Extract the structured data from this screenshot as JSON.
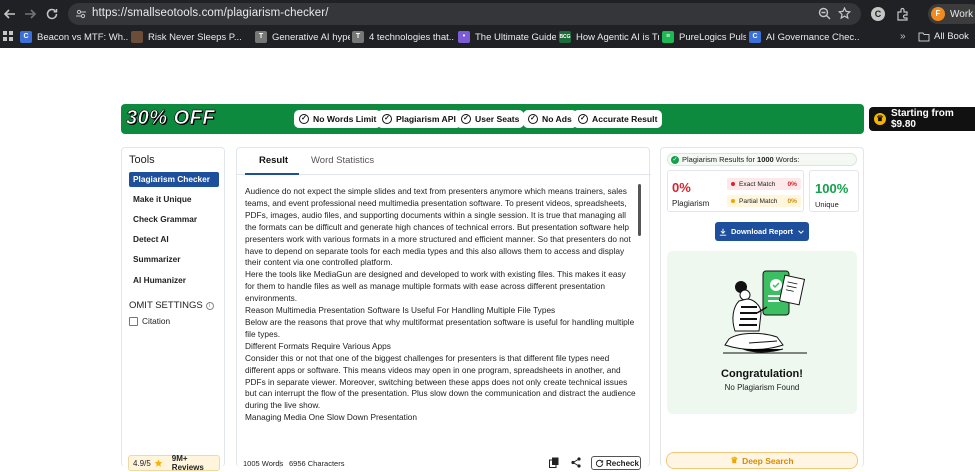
{
  "browser": {
    "url": "https://smallseotools.com/plagiarism-checker/",
    "profile_label": "Work",
    "profile_initial": "F",
    "extension_initial": "C",
    "bookmarks": [
      {
        "label": "Beacon vs MTF: Wh...",
        "icon": "c-favicon",
        "color": "#3c6fd8",
        "glyph": "C"
      },
      {
        "label": "Risk Never Sleeps P...",
        "icon": "image-favicon",
        "color": "#6b4d3a",
        "glyph": ""
      },
      {
        "label": "Generative AI hype...",
        "icon": "t-favicon",
        "color": "#777777",
        "glyph": "T"
      },
      {
        "label": "4 technologies that...",
        "icon": "t-favicon",
        "color": "#777777",
        "glyph": "T"
      },
      {
        "label": "The Ultimate Guide...",
        "icon": "purple-favicon",
        "color": "#7b5cd6",
        "glyph": "•"
      },
      {
        "label": "How Agentic AI is Tr...",
        "icon": "bcg-favicon",
        "color": "#1d6b3a",
        "glyph": "BCG"
      },
      {
        "label": "PureLogics Pulse | P...",
        "icon": "spotify-icon",
        "color": "#1db954",
        "glyph": "≡"
      },
      {
        "label": "AI Governance Chec...",
        "icon": "c-favicon",
        "color": "#3c6fd8",
        "glyph": "C"
      }
    ],
    "bookmarks_more": "»",
    "all_bookmarks": "All Book"
  },
  "promo": {
    "discount": "30% OFF",
    "features": [
      "No Words Limit",
      "Plagiarism API",
      "User Seats",
      "No Ads",
      "Accurate Result"
    ],
    "cta": "Starting from $9.80"
  },
  "tools": {
    "title": "Tools",
    "items": [
      "Plagiarism Checker",
      "Make it Unique",
      "Check Grammar",
      "Detect AI",
      "Summarizer",
      "AI Humanizer"
    ],
    "active_index": 0,
    "omit_title": "OMIT SETTINGS",
    "citation_label": "Citation",
    "rating": "4.9/5",
    "reviews": "9M+ Reviews"
  },
  "result": {
    "tabs": [
      "Result",
      "Word Statistics"
    ],
    "paragraphs": [
      "Audience do not expect the simple slides and text from presenters anymore which means trainers, sales teams, and event professional need multimedia presentation software. To present videos, spreadsheets, PDFs, images, audio files, and supporting documents within a single session. It is true that managing all the formats can be difficult and generate high chances of technical errors. But presentation software help presenters work with various formats in a more structured and efficient manner. So that presenters do not have to depend on separate tools for each media types and this also allows them to access and display their content via one controlled platform.",
      "Here the tools like MediaGun are designed and developed to work with existing files. This makes it easy for them to handle files as well as manage multiple formats with ease across different presentation environments.",
      "Reason Multimedia Presentation Software Is Useful For Handling Multiple File Types",
      "Below are the reasons that prove that why multiformat presentation software is useful for handling multiple file types.",
      "Different Formats Require Various Apps",
      "Consider this or not that one of the biggest challenges for presenters is that different file types need different apps or software. This means videos may open in one program, spreadsheets in another, and PDFs in separate viewer. Moreover, switching between these apps does not only create technical issues but can interrupt the flow of the presentation. Plus slow down the communication and distract the audience during the live show.",
      "Managing Media One Slow Down Presentation"
    ],
    "word_count": "1005 Words",
    "char_count": "6956 Characters",
    "recheck_label": "Recheck"
  },
  "results_panel": {
    "header_prefix": "Plagiarism Results for ",
    "header_words": "1000",
    "header_suffix": " Words:",
    "plagiarism_pct": "0%",
    "plagiarism_label": "Plagiarism",
    "exact_match_label": "Exact Match",
    "exact_match_value": "0%",
    "partial_match_label": "Partial Match",
    "partial_match_value": "0%",
    "unique_pct": "100%",
    "unique_label": "Unique",
    "download_label": "Download Report",
    "congrats_title": "Congratulation!",
    "congrats_subtitle": "No Plagiarism Found",
    "deep_search_label": "Deep Search"
  },
  "colors": {
    "promo_green": "#0d8a3e",
    "brand_blue": "#1e4f9c",
    "plagiarism_red": "#d9232d",
    "unique_green": "#13a04b",
    "deep_search_orange": "#d98a00"
  }
}
